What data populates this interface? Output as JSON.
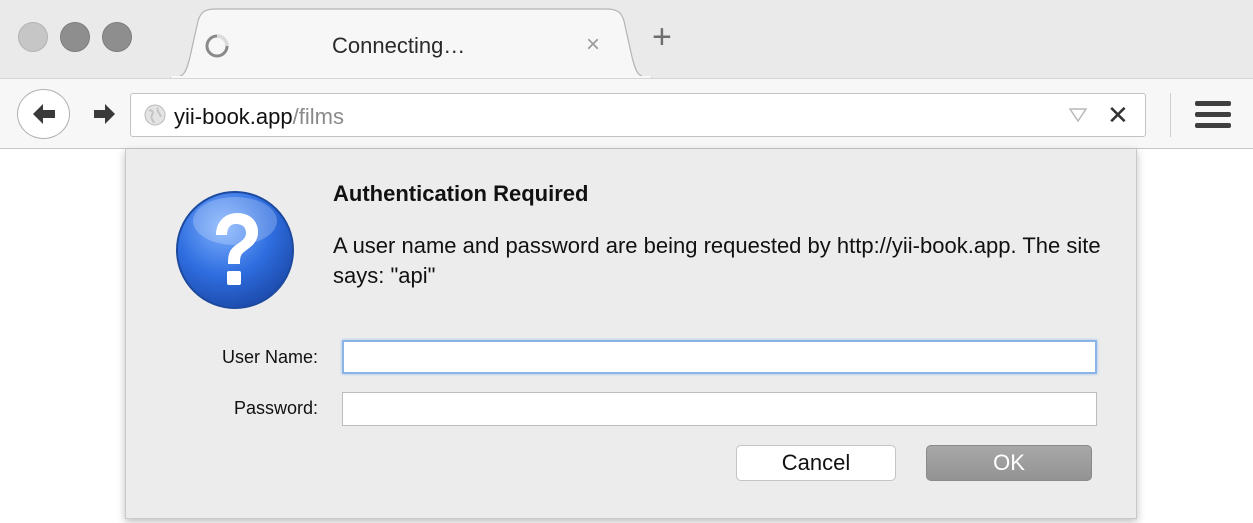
{
  "tab": {
    "title": "Connecting…",
    "close_icon": "×",
    "new_tab_icon": "+"
  },
  "toolbar": {
    "url_host": "yii-book.app",
    "url_path": "/films",
    "stop_icon": "✕"
  },
  "dialog": {
    "title": "Authentication Required",
    "message": "A user name and password are being requested by http://yii-book.app. The site says: \"api\"",
    "username_label": "User Name:",
    "password_label": "Password:",
    "username_value": "",
    "password_value": "",
    "cancel_label": "Cancel",
    "ok_label": "OK"
  },
  "colors": {
    "icon_blue": "#2f6ee0",
    "focus_ring": "#8ab4e8"
  }
}
